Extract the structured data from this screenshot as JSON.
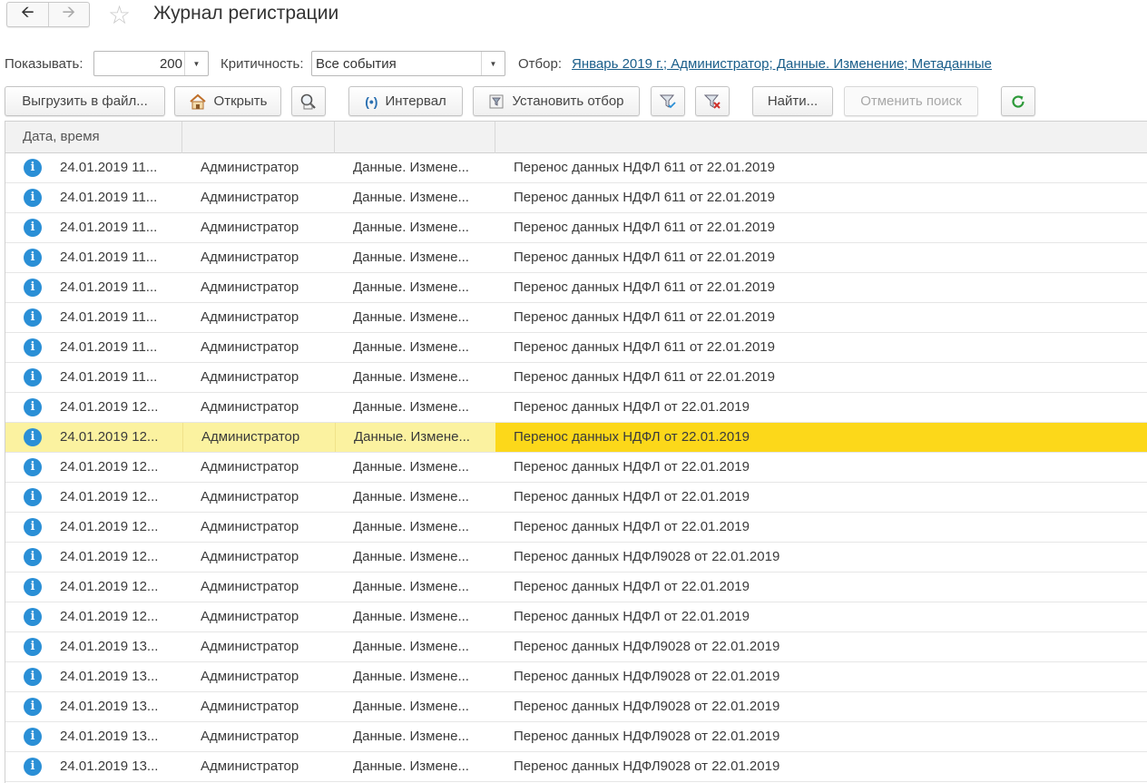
{
  "window": {
    "title": "Журнал регистрации"
  },
  "filters": {
    "show_label": "Показывать:",
    "show_value": "200",
    "criticality_label": "Критичность:",
    "criticality_value": "Все события",
    "selection_label": "Отбор:",
    "selection_link": "Январь 2019 г.; Администратор; Данные. Изменение; Метаданные"
  },
  "toolbar": {
    "export_label": "Выгрузить в файл...",
    "open_label": "Открыть",
    "interval_label": "Интервал",
    "set_filter_label": "Установить отбор",
    "find_label": "Найти...",
    "cancel_search_label": "Отменить поиск"
  },
  "table": {
    "columns": [
      "Дата, время",
      "",
      "",
      ""
    ],
    "selected_index": 9,
    "rows": [
      {
        "date": "24.01.2019 11...",
        "user": "Администратор",
        "event": "Данные. Измене...",
        "comment": "Перенос данных НДФЛ 611 от 22.01.2019"
      },
      {
        "date": "24.01.2019 11...",
        "user": "Администратор",
        "event": "Данные. Измене...",
        "comment": "Перенос данных НДФЛ 611 от 22.01.2019"
      },
      {
        "date": "24.01.2019 11...",
        "user": "Администратор",
        "event": "Данные. Измене...",
        "comment": "Перенос данных НДФЛ 611 от 22.01.2019"
      },
      {
        "date": "24.01.2019 11...",
        "user": "Администратор",
        "event": "Данные. Измене...",
        "comment": "Перенос данных НДФЛ 611 от 22.01.2019"
      },
      {
        "date": "24.01.2019 11...",
        "user": "Администратор",
        "event": "Данные. Измене...",
        "comment": "Перенос данных НДФЛ 611 от 22.01.2019"
      },
      {
        "date": "24.01.2019 11...",
        "user": "Администратор",
        "event": "Данные. Измене...",
        "comment": "Перенос данных НДФЛ 611 от 22.01.2019"
      },
      {
        "date": "24.01.2019 11...",
        "user": "Администратор",
        "event": "Данные. Измене...",
        "comment": "Перенос данных НДФЛ 611 от 22.01.2019"
      },
      {
        "date": "24.01.2019 11...",
        "user": "Администратор",
        "event": "Данные. Измене...",
        "comment": "Перенос данных НДФЛ 611 от 22.01.2019"
      },
      {
        "date": "24.01.2019 12...",
        "user": "Администратор",
        "event": "Данные. Измене...",
        "comment": "Перенос данных НДФЛ от 22.01.2019"
      },
      {
        "date": "24.01.2019 12...",
        "user": "Администратор",
        "event": "Данные. Измене...",
        "comment": "Перенос данных НДФЛ от 22.01.2019"
      },
      {
        "date": "24.01.2019 12...",
        "user": "Администратор",
        "event": "Данные. Измене...",
        "comment": "Перенос данных НДФЛ от 22.01.2019"
      },
      {
        "date": "24.01.2019 12...",
        "user": "Администратор",
        "event": "Данные. Измене...",
        "comment": "Перенос данных НДФЛ от 22.01.2019"
      },
      {
        "date": "24.01.2019 12...",
        "user": "Администратор",
        "event": "Данные. Измене...",
        "comment": "Перенос данных НДФЛ от 22.01.2019"
      },
      {
        "date": "24.01.2019 12...",
        "user": "Администратор",
        "event": "Данные. Измене...",
        "comment": "Перенос данных НДФЛ9028 от 22.01.2019"
      },
      {
        "date": "24.01.2019 12...",
        "user": "Администратор",
        "event": "Данные. Измене...",
        "comment": "Перенос данных НДФЛ от 22.01.2019"
      },
      {
        "date": "24.01.2019 12...",
        "user": "Администратор",
        "event": "Данные. Измене...",
        "comment": "Перенос данных НДФЛ от 22.01.2019"
      },
      {
        "date": "24.01.2019 13...",
        "user": "Администратор",
        "event": "Данные. Измене...",
        "comment": "Перенос данных НДФЛ9028 от 22.01.2019"
      },
      {
        "date": "24.01.2019 13...",
        "user": "Администратор",
        "event": "Данные. Измене...",
        "comment": "Перенос данных НДФЛ9028 от 22.01.2019"
      },
      {
        "date": "24.01.2019 13...",
        "user": "Администратор",
        "event": "Данные. Измене...",
        "comment": "Перенос данных НДФЛ9028 от 22.01.2019"
      },
      {
        "date": "24.01.2019 13...",
        "user": "Администратор",
        "event": "Данные. Измене...",
        "comment": "Перенос данных НДФЛ9028 от 22.01.2019"
      },
      {
        "date": "24.01.2019 13...",
        "user": "Администратор",
        "event": "Данные. Измене...",
        "comment": "Перенос данных НДФЛ9028 от 22.01.2019"
      }
    ]
  },
  "icons": {
    "row_icon": "info-icon",
    "nav_back": "arrow-left-icon",
    "nav_forward": "arrow-right-icon",
    "favorite": "star-icon",
    "refresh": "refresh-icon"
  },
  "colors": {
    "selected_row": "#fbf2a0",
    "selected_cell": "#fcd81a",
    "info_icon": "#2a8fd6",
    "link": "#1a5e8a"
  }
}
